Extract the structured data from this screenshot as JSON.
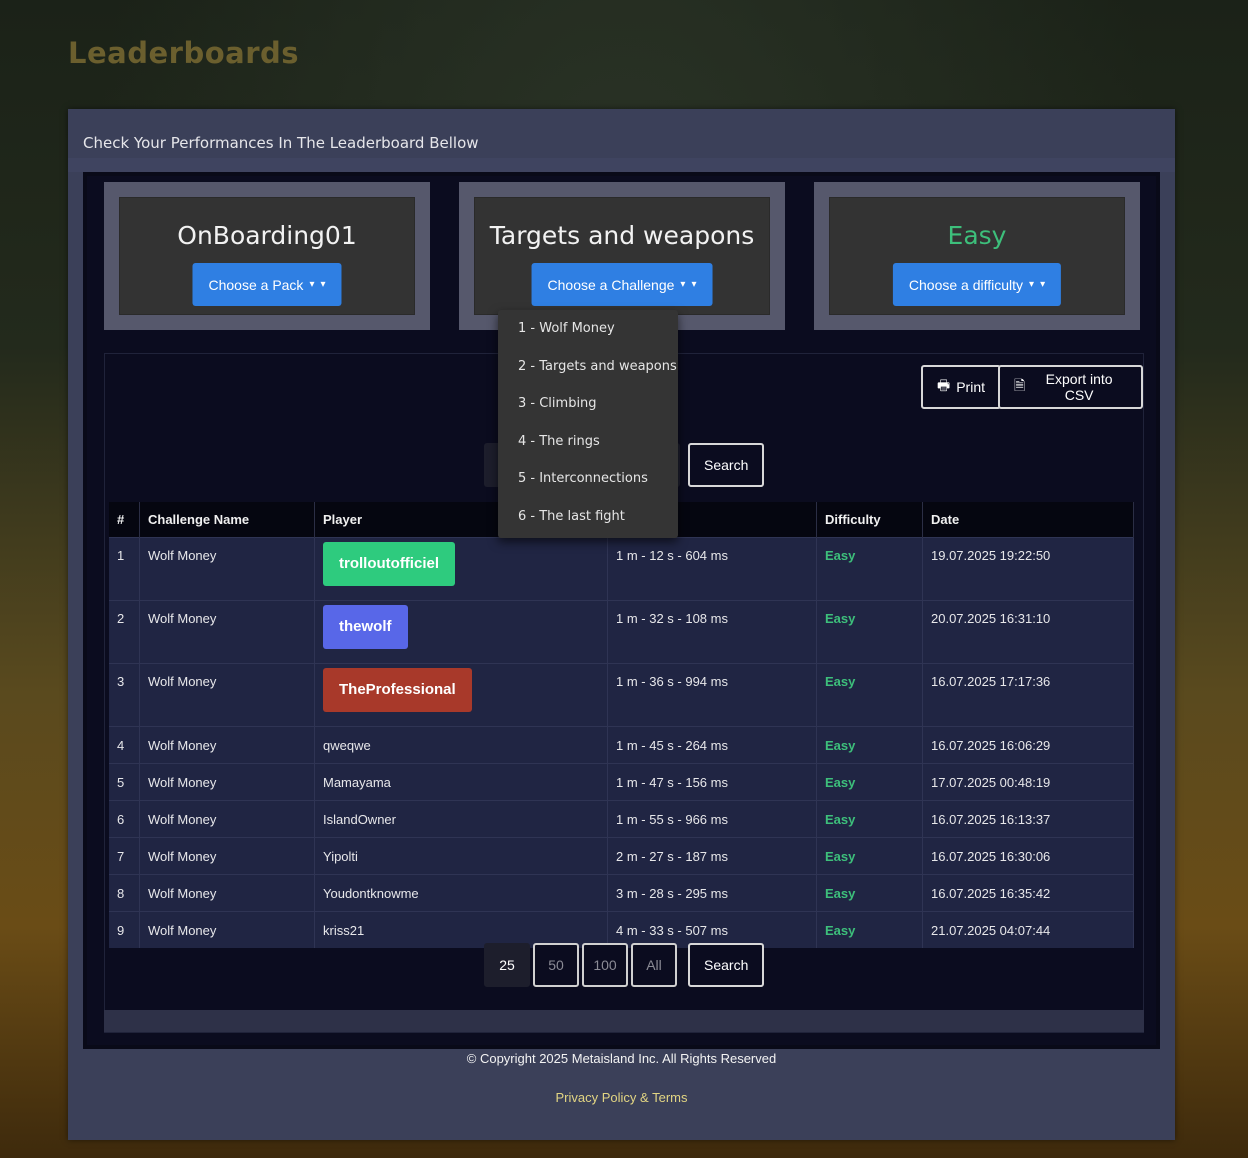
{
  "page_title": "Leaderboards",
  "subtitle": "Check Your Performances In The Leaderboard Bellow",
  "cards": [
    {
      "value": "OnBoarding01",
      "button": "Choose a Pack"
    },
    {
      "value": "Targets and weapons",
      "button": "Choose a Challenge"
    },
    {
      "value": "Easy",
      "button": "Choose a difficulty"
    }
  ],
  "toolbar": {
    "print": "Print",
    "export": "Export into CSV"
  },
  "search_label": "Search",
  "challenge_menu": [
    "1 - Wolf Money",
    "2 - Targets and weapons",
    "3 - Climbing",
    "4 - The rings",
    "5 - Interconnections",
    "6 - The last fight"
  ],
  "table": {
    "headers": [
      "#",
      "Challenge Name",
      "Player",
      "",
      "Difficulty",
      "Date"
    ],
    "rows": [
      {
        "rank": "1",
        "challenge": "Wolf Money",
        "player": "trolloutofficiel",
        "time": "1 m - 12 s - 604 ms",
        "difficulty": "Easy",
        "date": "19.07.2025 19:22:50"
      },
      {
        "rank": "2",
        "challenge": "Wolf Money",
        "player": "thewolf",
        "time": "1 m - 32 s - 108 ms",
        "difficulty": "Easy",
        "date": "20.07.2025 16:31:10"
      },
      {
        "rank": "3",
        "challenge": "Wolf Money",
        "player": "TheProfessional",
        "time": "1 m - 36 s - 994 ms",
        "difficulty": "Easy",
        "date": "16.07.2025 17:17:36"
      },
      {
        "rank": "4",
        "challenge": "Wolf Money",
        "player": "qweqwe",
        "time": "1 m - 45 s - 264 ms",
        "difficulty": "Easy",
        "date": "16.07.2025 16:06:29"
      },
      {
        "rank": "5",
        "challenge": "Wolf Money",
        "player": "Mamayama",
        "time": "1 m - 47 s - 156 ms",
        "difficulty": "Easy",
        "date": "17.07.2025 00:48:19"
      },
      {
        "rank": "6",
        "challenge": "Wolf Money",
        "player": "IslandOwner",
        "time": "1 m - 55 s - 966 ms",
        "difficulty": "Easy",
        "date": "16.07.2025 16:13:37"
      },
      {
        "rank": "7",
        "challenge": "Wolf Money",
        "player": "Yipolti",
        "time": "2 m - 27 s - 187 ms",
        "difficulty": "Easy",
        "date": "16.07.2025 16:30:06"
      },
      {
        "rank": "8",
        "challenge": "Wolf Money",
        "player": "Youdontknowme",
        "time": "3 m - 28 s - 295 ms",
        "difficulty": "Easy",
        "date": "16.07.2025 16:35:42"
      },
      {
        "rank": "9",
        "challenge": "Wolf Money",
        "player": "kriss21",
        "time": "4 m - 33 s - 507 ms",
        "difficulty": "Easy",
        "date": "21.07.2025 04:07:44"
      }
    ]
  },
  "badge_colors": {
    "gold": "#2ecb7e",
    "silver": "#5867e8",
    "bronze": "#a8392a"
  },
  "pager": [
    "25",
    "50",
    "100",
    "All"
  ],
  "footer": {
    "copyright": "© Copyright 2025 Metaisland Inc. All Rights Reserved",
    "privacy": "Privacy Policy & Terms"
  }
}
